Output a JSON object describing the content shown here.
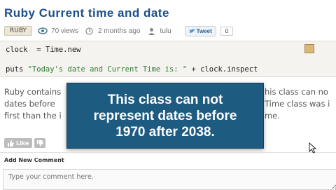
{
  "post": {
    "title": "Ruby Current time and date",
    "tag": "RUBY",
    "views": "70 views",
    "time_ago": "2 months ago",
    "author": "tulu",
    "tweet_label": "Tweet",
    "tweet_count": "0"
  },
  "code": {
    "line1": "clock  = Time.new",
    "line2_prefix": "puts ",
    "line2_string": "\"Today's date and Current Time is: \"",
    "line2_suffix": " + clock.inspect"
  },
  "body_text": {
    "line1_left": "Ruby contains",
    "line1_right": "his class can no",
    "line2_left": "dates before",
    "line2_right": "Time class was i",
    "line3_left": "first than the i",
    "line3_right": "me."
  },
  "overlay": {
    "line1": "This class can not",
    "line2": "represent dates before",
    "line3": "1970 after 2038."
  },
  "actions": {
    "like_label": "Like"
  },
  "comments": {
    "heading": "Add New Comment",
    "placeholder": "Type your comment here."
  },
  "colors": {
    "title": "#1c4f8a",
    "overlay_bg": "#1e5b80",
    "code_bg": "#f5f3ef"
  }
}
